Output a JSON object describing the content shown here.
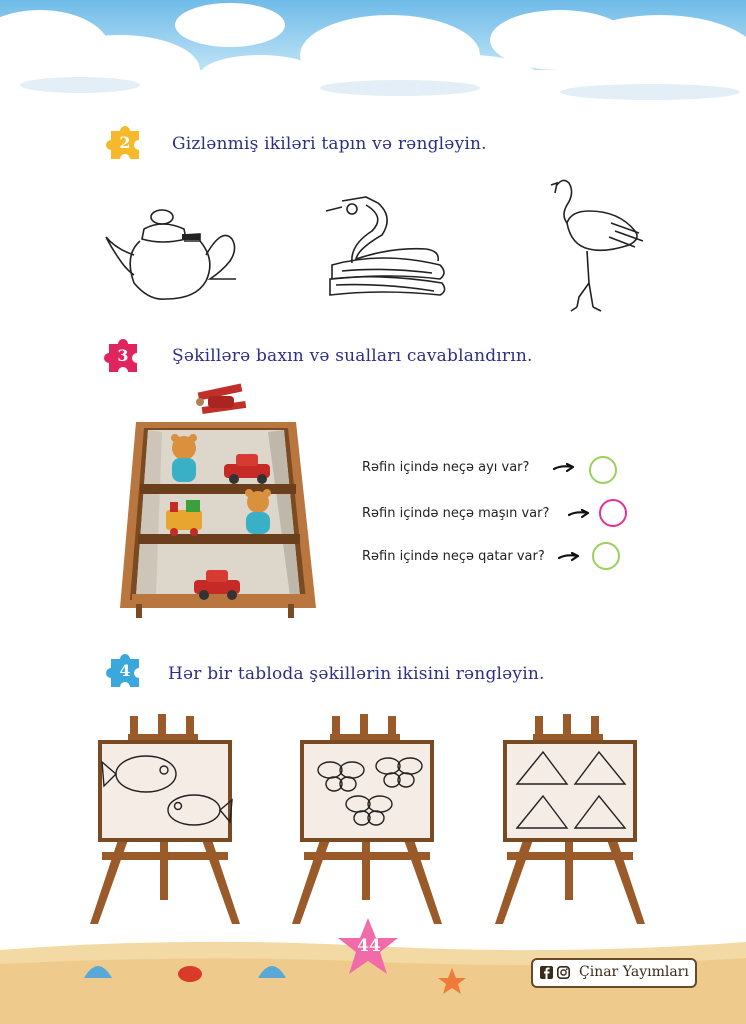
{
  "tasks": [
    {
      "number": "2",
      "title": "Gizlənmiş ikiləri tapın və rəngləyin.",
      "puzzle_color": "#f6b92b"
    },
    {
      "number": "3",
      "title": "Şəkillərə baxın və sualları cavablandırın.",
      "puzzle_color": "#e0245e"
    },
    {
      "number": "4",
      "title": "Hər bir tabloda şəkillərin ikisini rəngləyin.",
      "puzzle_color": "#3aa7dd"
    }
  ],
  "questions": [
    {
      "text": "Rəfin içində neçə ayı var?",
      "circle_color": "#9ad15a"
    },
    {
      "text": "Rəfin içində neçə maşın var?",
      "circle_color": "#e5338f"
    },
    {
      "text": "Rəfin içində neçə qatar var?",
      "circle_color": "#9ad15a"
    }
  ],
  "page_number": "44",
  "brand": {
    "name": "Çinar Yayımları",
    "icons": [
      "facebook-icon",
      "instagram-icon"
    ]
  },
  "colors": {
    "title": "#2c2f86",
    "sky": "#7dc3ea",
    "sand": "#f3d9a3",
    "starfish": "#f06ba8"
  }
}
